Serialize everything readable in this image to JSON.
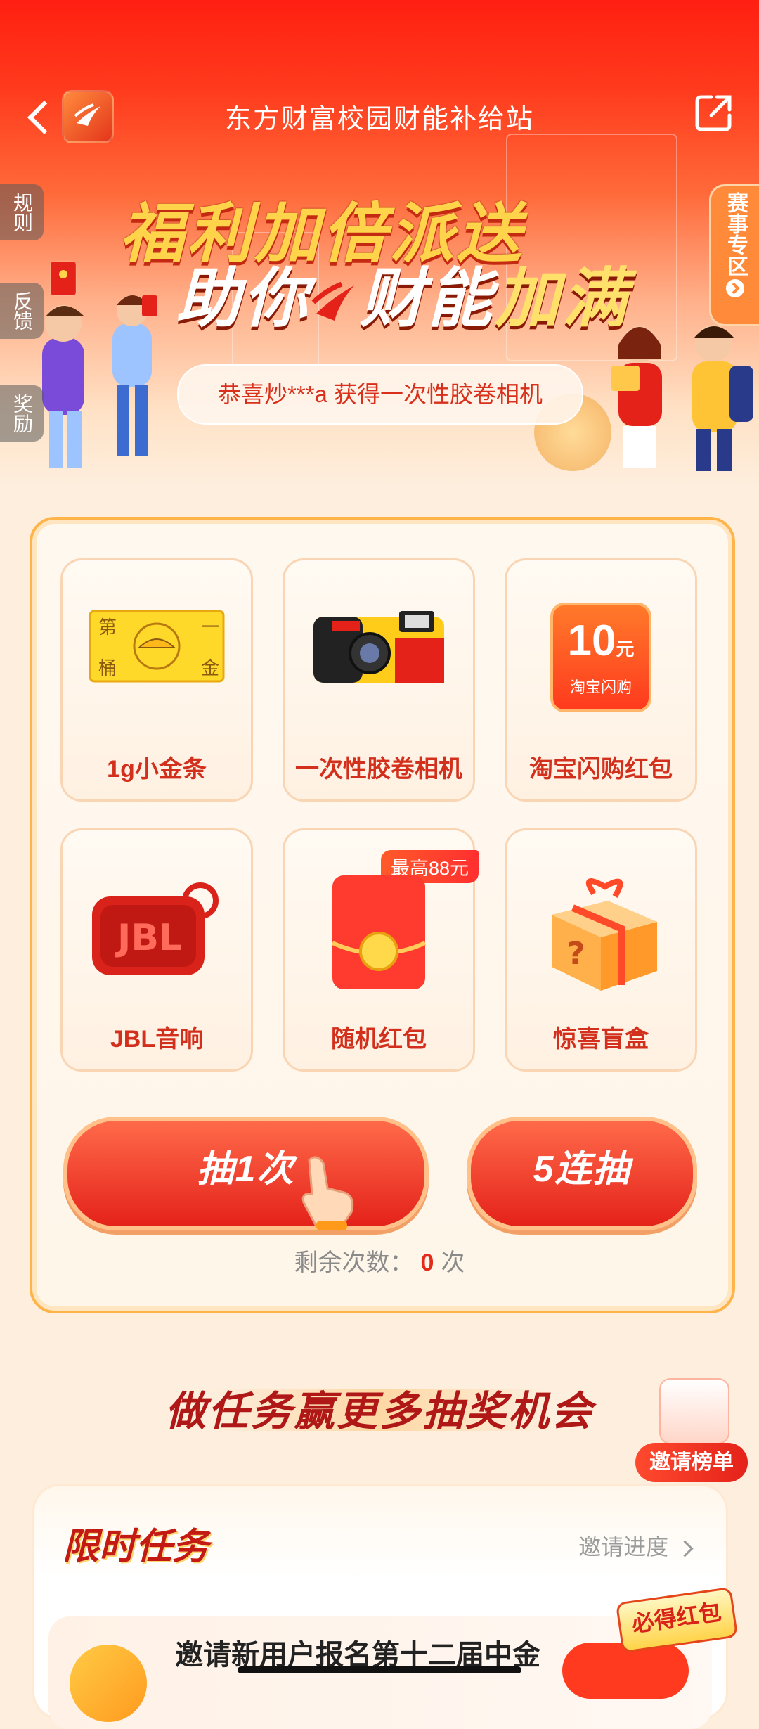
{
  "header": {
    "title": "东方财富校园财能补给站"
  },
  "side_tabs": {
    "rules": "规则",
    "feedback": "反馈",
    "rewards": "奖励"
  },
  "right_tab": {
    "label": "赛事专区"
  },
  "banner": {
    "line1": "福利加倍派送",
    "line2_a": "助你",
    "line2_b": "财能",
    "line2_c": "加满",
    "winner_notice": "恭喜炒***a 获得一次性胶卷相机"
  },
  "prizes": [
    {
      "label": "1g小金条",
      "icon": "gold-bar-icon"
    },
    {
      "label": "一次性胶卷相机",
      "icon": "camera-icon"
    },
    {
      "label": "淘宝闪购红包",
      "icon": "taobao-voucher-icon",
      "voucher_amount": "10",
      "voucher_unit": "元",
      "voucher_sub": "淘宝闪购"
    },
    {
      "label": "JBL音响",
      "icon": "speaker-icon"
    },
    {
      "label": "随机红包",
      "icon": "red-envelope-icon",
      "badge": "最高88元"
    },
    {
      "label": "惊喜盲盒",
      "icon": "mystery-box-icon"
    }
  ],
  "draw": {
    "single": "抽1次",
    "multi": "5连抽",
    "remaining_label": "剩余次数：",
    "remaining_count": "0",
    "remaining_unit": "次"
  },
  "tasks": {
    "heading": "做任务赢更多抽奖机会",
    "invite_rank": "邀请榜单",
    "limited_title": "限时任务",
    "invite_progress": "邀请进度",
    "first_task": "邀请新用户报名第十二届中金",
    "must_red": "必得红包"
  },
  "colors": {
    "primary_red": "#e4221a",
    "gold": "#ffb44a",
    "label_red": "#d2301c"
  }
}
